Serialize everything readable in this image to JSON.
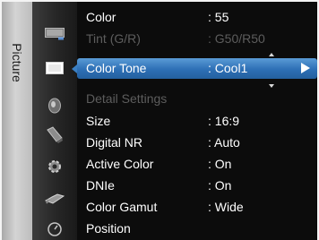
{
  "category": {
    "label": "Picture"
  },
  "icons": [
    "picture-icon",
    "sound-icon",
    "setup-icon",
    "input-icon",
    "application-icon",
    "support-icon",
    "guide-icon"
  ],
  "menu": {
    "items": [
      {
        "label": "Color",
        "value": ": 55",
        "dim": false
      },
      {
        "label": "Tint (G/R)",
        "value": ": G50/R50",
        "dim": true
      },
      {
        "label": "Color Tone",
        "value": ": Cool1",
        "dim": false,
        "selected": true
      },
      {
        "label": "Detail Settings",
        "value": "",
        "dim": true
      },
      {
        "label": "Size",
        "value": ": 16:9",
        "dim": false
      },
      {
        "label": "Digital NR",
        "value": ": Auto",
        "dim": false
      },
      {
        "label": "Active Color",
        "value": ": On",
        "dim": false
      },
      {
        "label": "DNIe",
        "value": ": On",
        "dim": false
      },
      {
        "label": "Color Gamut",
        "value": ": Wide",
        "dim": false
      },
      {
        "label": "Position",
        "value": "",
        "dim": false
      }
    ]
  },
  "colors": {
    "highlight": "#2d6fb5",
    "background": "#0c0c0c",
    "text": "#ffffff",
    "dim_text": "#5d5d5d"
  }
}
